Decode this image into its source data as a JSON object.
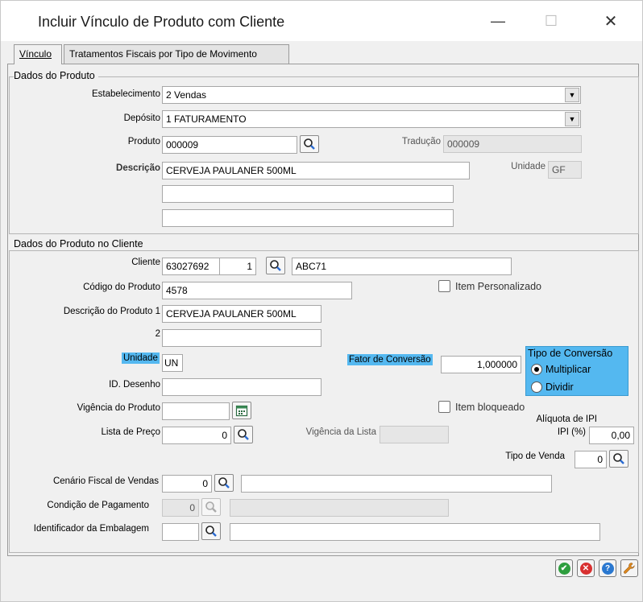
{
  "window": {
    "title": "Incluir Vínculo de Produto com Cliente",
    "minimize_glyph": "—",
    "maximize_glyph": "☐",
    "close_glyph": "✕"
  },
  "tabs": [
    {
      "label": "Vínculo",
      "active": true
    },
    {
      "label": "Tratamentos Fiscais por Tipo de Movimento",
      "active": false
    }
  ],
  "produto": {
    "group_title": "Dados do Produto",
    "estabelecimento_label": "Estabelecimento",
    "estabelecimento_value": "2 Vendas",
    "deposito_label": "Depósito",
    "deposito_value": "1 FATURAMENTO",
    "produto_label": "Produto",
    "produto_value": "000009",
    "traducao_label": "Tradução",
    "traducao_value": "000009",
    "descricao_label": "Descrição",
    "descricao_value": "CERVEJA PAULANER 500ML",
    "descricao2_value": "",
    "descricao3_value": "",
    "unidade_label": "Unidade",
    "unidade_value": "GF"
  },
  "cliente": {
    "group_title": "Dados do Produto no Cliente",
    "cliente_label": "Cliente",
    "cliente_code": "63027692",
    "cliente_seq": "1",
    "cliente_name": "ABC71",
    "codigo_label": "Código do Produto",
    "codigo_value": "4578",
    "item_personalizado_label": "Item Personalizado",
    "desc1_label": "Descrição do Produto 1",
    "desc1_value": "CERVEJA PAULANER 500ML",
    "desc2_label": "2",
    "desc2_value": "",
    "unidade_label": "Unidade",
    "unidade_value": "UN",
    "fator_label": "Fator de Conversão",
    "fator_value": "1,000000",
    "tipo_conversao_title": "Tipo de Conversão",
    "multiplicar_label": "Multiplicar",
    "dividir_label": "Dividir",
    "tipo_conversao_selected": "Multiplicar",
    "desenho_label": "ID. Desenho",
    "desenho_value": "",
    "vigencia_label": "Vigência do Produto",
    "vigencia_value": "",
    "item_bloqueado_label": "Item bloqueado",
    "lista_label": "Lista de Preço",
    "lista_value": "0",
    "vigencia_lista_label": "Vigência da Lista",
    "vigencia_lista_value": "",
    "aliquota_label": "Alíquota de IPI",
    "ipi_label": "IPI (%)",
    "ipi_value": "0,00",
    "tipo_venda_label": "Tipo de Venda",
    "tipo_venda_value": "0",
    "cenario_label": "Cenário Fiscal de Vendas",
    "cenario_value": "0",
    "cenario_desc": "",
    "condicao_label": "Condição de Pagamento",
    "condicao_value": "0",
    "condicao_desc": "",
    "embalagem_label": "Identificador da Embalagem",
    "embalagem_value": "",
    "embalagem_desc": ""
  },
  "footer_buttons": [
    {
      "name": "confirm",
      "glyph": "✔",
      "color": "#2e9e3e"
    },
    {
      "name": "cancel",
      "glyph": "✕",
      "color": "#d83030"
    },
    {
      "name": "help",
      "glyph": "?",
      "color": "#2a78d0"
    },
    {
      "name": "tools",
      "glyph": "🔧",
      "color": "#e08a1e"
    }
  ]
}
